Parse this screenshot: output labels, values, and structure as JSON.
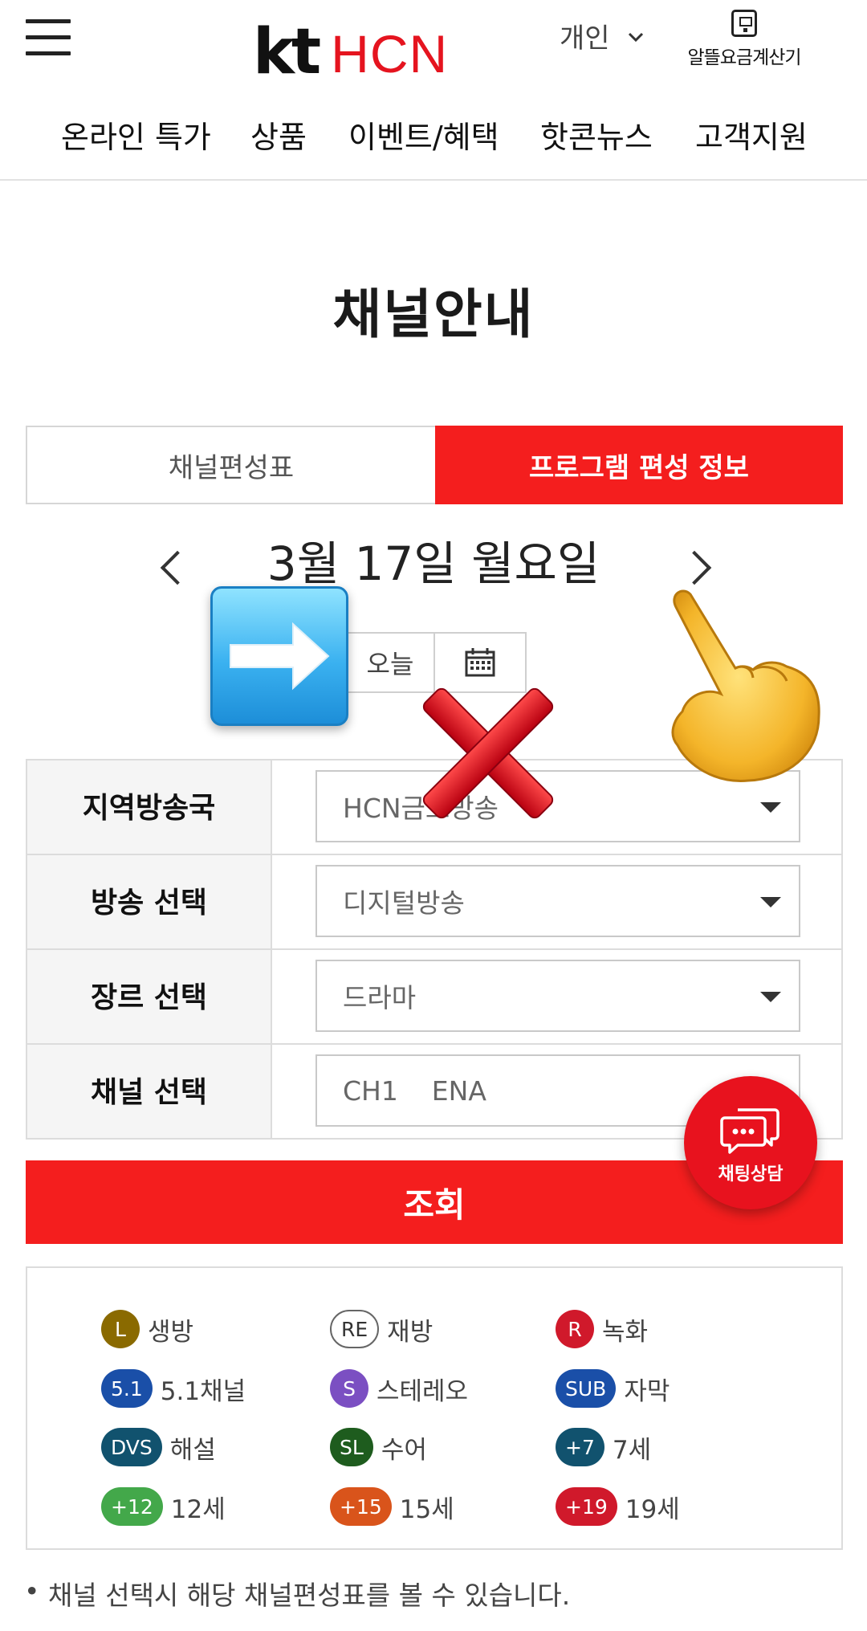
{
  "header": {
    "logo_kt": "kt",
    "logo_hcn": "HCN",
    "user_type": "개인",
    "calculator_label": "알뜰요금계산기"
  },
  "nav": {
    "items": [
      "온라인 특가",
      "상품",
      "이벤트/혜택",
      "핫콘뉴스",
      "고객지원"
    ]
  },
  "page": {
    "title": "채널안내"
  },
  "tabs": {
    "channel_lineup": "채널편성표",
    "program_schedule": "프로그램 편성 정보",
    "active": "프로그램 편성 정보"
  },
  "date_nav": {
    "date": "3월 17일 월요일",
    "today_label": "오늘"
  },
  "form": {
    "rows": [
      {
        "label": "지역방송국",
        "value": "HCN금호방송"
      },
      {
        "label": "방송 선택",
        "value": "디지털방송"
      },
      {
        "label": "장르 선택",
        "value": "드라마"
      },
      {
        "label": "채널 선택",
        "value": "CH1    ENA"
      }
    ],
    "search_label": "조회"
  },
  "chat": {
    "label": "채팅상담"
  },
  "legend": {
    "items": [
      {
        "badge": "L",
        "text": "생방",
        "color": "#8a6a00"
      },
      {
        "badge": "RE",
        "text": "재방",
        "color": "outline"
      },
      {
        "badge": "R",
        "text": "녹화",
        "color": "#d0192b"
      },
      {
        "badge": "5.1",
        "text": "5.1채널",
        "color": "#1a4fa8"
      },
      {
        "badge": "S",
        "text": "스테레오",
        "color": "#7b4fc2"
      },
      {
        "badge": "SUB",
        "text": "자막",
        "color": "#1a4fa8"
      },
      {
        "badge": "DVS",
        "text": "해설",
        "color": "#11526e"
      },
      {
        "badge": "SL",
        "text": "수어",
        "color": "#1e5c1e"
      },
      {
        "badge": "+7",
        "text": "7세",
        "color": "#11526e"
      },
      {
        "badge": "+12",
        "text": "12세",
        "color": "#43a84a"
      },
      {
        "badge": "+15",
        "text": "15세",
        "color": "#d9541b"
      },
      {
        "badge": "+19",
        "text": "19세",
        "color": "#d0192b"
      }
    ]
  },
  "notes": {
    "text": "채널 선택시 해당 채널편성표를 볼 수 있습니다."
  },
  "colors": {
    "brand_red": "#f41e1e",
    "logo_red": "#e5141f"
  }
}
